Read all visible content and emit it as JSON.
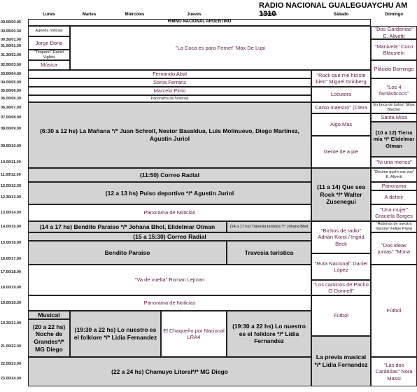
{
  "title": "RADIO NACIONAL GUALEGUAYCHU AM 1310",
  "days": [
    "Lunes",
    "Martes",
    "Miércoles",
    "Jueves",
    "Viernes",
    "Sábado",
    "Domingo"
  ],
  "times": [
    "00.00/00.05",
    "00.05/00.30",
    "00.30/01.00",
    "01.00/01.30",
    "01.30/02.00",
    "02.00/03.00",
    "03.00/04.00",
    "04.00/05.00",
    "05.00/06.00",
    "06.00/06.30",
    "06.30/07.00",
    "07.00/08.00",
    "08.00/09.00",
    "09.00/10.00",
    "10.00/11.00",
    "11.00/12.00",
    "12.00/12.30",
    "12.30/13.00",
    "13.00/14.00",
    "14.00/15.00",
    "15.00/16.00",
    "16.00/17.00",
    "17.00/18.00",
    "18.00/19.00",
    "19.00/19.30",
    "19.30/21.00",
    "21.00/22.00",
    "22.00/23.00",
    "23.00/24.00"
  ],
  "programs": {
    "himno": "HIMNO NACIONAL ARGENTINO",
    "agenda": "Agenda noticias",
    "jorge": "Jorge Dorio",
    "timpano": "\"Timpano\" Daniel Vigliett",
    "musica": "Música",
    "coca": "\"La Coca es para Fernet\" Max De Lupi",
    "dos_gardenias": "\"Dos Gardenias\" E. Alivetti",
    "manivela": "\"Manivela\" Coco Blaustein",
    "placido": "Plácido Domingo",
    "fernando": "Fernando Abal",
    "sonia": "Sonia Ferraris",
    "marcelo": "Marcelo Pinto",
    "panorama_small": "Panorama de Noticias",
    "rock_hiciste": "\"Rock que me hiciste bien\" Miguel Grinberg",
    "locutora": "Locutora",
    "cuatro_fant": "\"Los 4 fantásticocs\"",
    "canto": "Canto maestro\" (Ctera",
    "en_boca": "En boca de todos! Silvia Blacher",
    "santa_misa": "Santa Misa",
    "manana": "(6:30 a 12 hs) La Mañana */* Juan Schroll, Nestor Basaldua, Luis Molinuevo, Diego Martinez, Agustin Juriol",
    "algo_mas": "Algo Mas",
    "tierra_mia": "(10 a 12) Tierra mía */* Elidelmar Otman",
    "gente_pie": "Gente de a pie",
    "ni_menos": "\"Ni una menos\"",
    "decime": "\"Decime quién sos vos\" E. Aliverti",
    "correo1": "(11:50)  Correo Radial",
    "que_sea_rock": "(11 a 14) Que sea Rock */* Walter Zusenegui",
    "panorama_dom": "Panorama",
    "pulso": "(12 a 13 hs) Pulso deportivo */* Agustin Juriol",
    "a_definir": "A definir",
    "panorama13": "Panorama de Noticias",
    "una_mujer": "\"Una mujer\" Graciela Borges",
    "paraiso": "(14 a 17 hs) Bendito Paraiso */* Johana Bhol, Elidelmar Otman",
    "travesia_small": "(14 a 17 hs) Travesia turistica */* Johana Bhol",
    "historias": "\"Historias de nuestra historia\" Felipe Pigna",
    "correo2": "(15 a 15:30) Correo Radial",
    "bichos": "\"Bichos de radio\" Adrián Korol / Ingrid Beck",
    "bendito": "Bendito Paraiso",
    "travesia": "Travesia turistica",
    "dos_ideas": "\"Dos ideas juntas\" \"Mona",
    "ruta": "\"Ruta Nacional\" Daniel López",
    "vuelta": "\"Va de vuelta\" Roman Lejman",
    "caminos": "\"Los caminos de Pacho O´Donnell\"",
    "panorama19": "Panorama de Noticias",
    "futbol_sab": "Fútbol",
    "futbol_dom": "Fútbol",
    "musical": "Musical",
    "noche": "(20 a 22 hs) Noche de Grandes*/* MG Diego",
    "folklore1": "(19:30 a 22 hs) Lo nuestro es el folklore */* Lidia Fernandez",
    "chaqueno": "El Chaqueño por Nacional LRA4",
    "folklore2": "(19:30 a 22 hs) Lo nuestro es el folklore */* Lidia Fernandez",
    "previa": "La previa musical */* Lidia Fernandez",
    "chamuyo": "(22 a 24 hs) Chamuyo Litoral*/* MG Diego",
    "caratulas": "\"Las dos Carátulas\" Nora Massi"
  }
}
